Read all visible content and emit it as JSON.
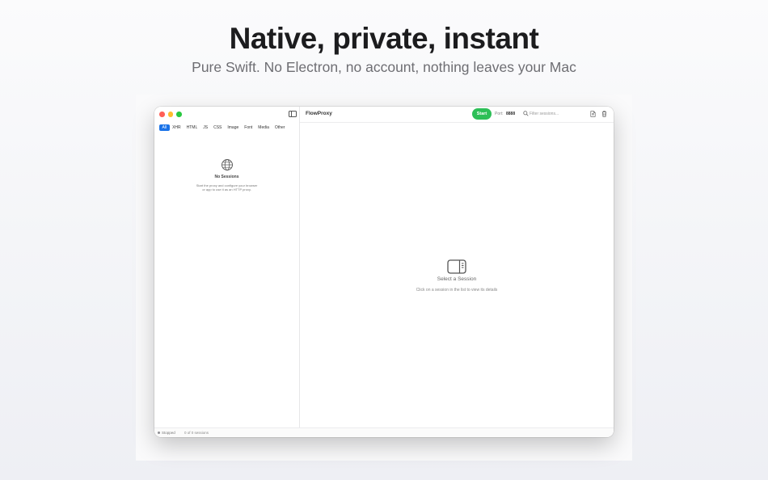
{
  "hero": {
    "headline": "Native, private, instant",
    "subhead": "Pure Swift. No Electron, no account, nothing leaves your Mac"
  },
  "window": {
    "title": "FlowProxy"
  },
  "sidebar": {
    "filters": [
      {
        "label": "All",
        "active": true
      },
      {
        "label": "XHR",
        "active": false
      },
      {
        "label": "HTML",
        "active": false
      },
      {
        "label": "JS",
        "active": false
      },
      {
        "label": "CSS",
        "active": false
      },
      {
        "label": "Image",
        "active": false
      },
      {
        "label": "Font",
        "active": false
      },
      {
        "label": "Media",
        "active": false
      },
      {
        "label": "Other",
        "active": false
      }
    ],
    "empty": {
      "icon": "globe-icon",
      "title": "No Sessions",
      "desc_line1": "Start the proxy and configure your browser",
      "desc_line2": "or app to use it as an HTTP proxy."
    }
  },
  "toolbar": {
    "start_label": "Start",
    "port_label": "Port:",
    "port_value": "8888",
    "search_placeholder": "Filter sessions...",
    "search_value": ""
  },
  "detail": {
    "icon": "sidebar-panel-icon",
    "title": "Select a Session",
    "desc": "Click on a session in the list to view its details"
  },
  "status": {
    "state": "Stopped",
    "count": "0 of 0 sessions"
  },
  "colors": {
    "accent": "#1a73e8",
    "start_green": "#2dbf57",
    "close": "#ff5f57",
    "minimize": "#febc2e",
    "zoom": "#28c840"
  }
}
